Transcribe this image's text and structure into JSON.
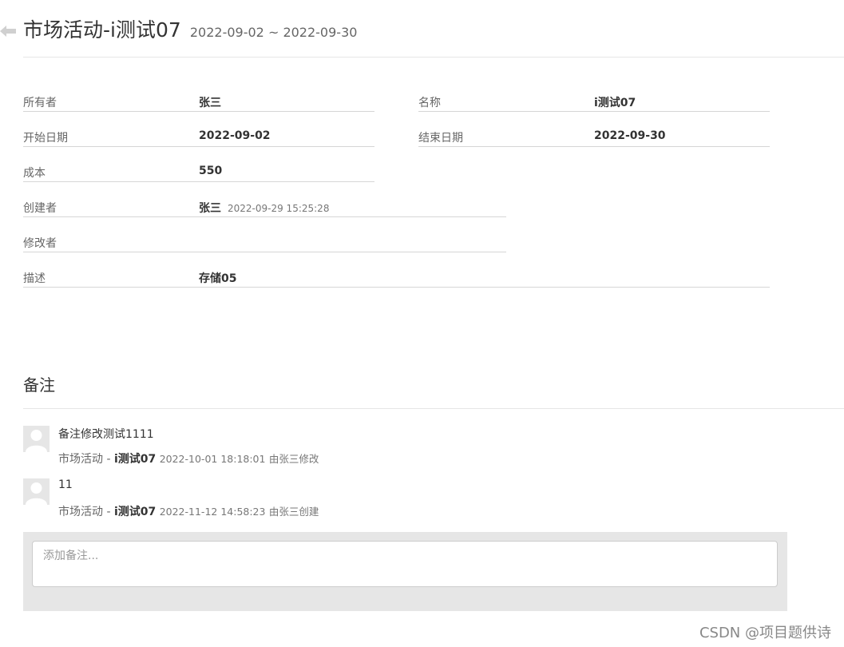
{
  "header": {
    "title": "市场活动-i测试07",
    "date_range": "2022-09-02 ~ 2022-09-30"
  },
  "details": {
    "owner": {
      "label": "所有者",
      "value": "张三"
    },
    "name": {
      "label": "名称",
      "value": "i测试07"
    },
    "start_date": {
      "label": "开始日期",
      "value": "2022-09-02"
    },
    "end_date": {
      "label": "结束日期",
      "value": "2022-09-30"
    },
    "cost": {
      "label": "成本",
      "value": "550"
    },
    "creator": {
      "label": "创建者",
      "value": "张三",
      "time": "2022-09-29 15:25:28"
    },
    "editor": {
      "label": "修改者",
      "value": ""
    },
    "description": {
      "label": "描述",
      "value": "存储05"
    }
  },
  "notes": {
    "heading": "备注",
    "items": [
      {
        "text": "备注修改测试1111",
        "source": "市场活动 -",
        "activity": "i测试07",
        "time": "2022-10-01 18:18:01",
        "action": "由张三修改"
      },
      {
        "text": "11",
        "source": "市场活动 -",
        "activity": "i测试07",
        "time": "2022-11-12 14:58:23",
        "action": "由张三创建"
      }
    ],
    "add_placeholder": "添加备注..."
  },
  "watermark": "CSDN @项目题供诗"
}
